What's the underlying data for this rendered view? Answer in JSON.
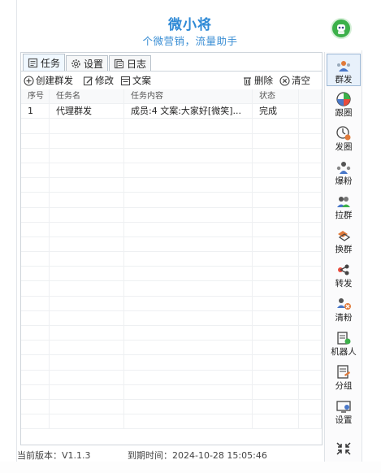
{
  "header": {
    "title": "微小将",
    "subtitle": "个微营销，流量助手"
  },
  "tabs": [
    {
      "label": "任务",
      "icon": "task-icon",
      "active": true
    },
    {
      "label": "设置",
      "icon": "gear-icon",
      "active": false
    },
    {
      "label": "日志",
      "icon": "log-icon",
      "active": false
    }
  ],
  "toolbar": {
    "create_label": "创建群发",
    "edit_label": "修改",
    "copy_label": "文案",
    "delete_label": "删除",
    "clear_label": "清空"
  },
  "table": {
    "columns": [
      "序号",
      "任务名",
      "任务内容",
      "状态"
    ],
    "rows": [
      {
        "index": "1",
        "name": "代理群发",
        "content": "成员:4 文案:大家好[微笑]...",
        "status": "完成"
      }
    ]
  },
  "sidebar": {
    "items": [
      {
        "label": "群发",
        "icon": "broadcast-icon",
        "active": true
      },
      {
        "label": "跟圈",
        "icon": "moments-follow-icon",
        "active": false
      },
      {
        "label": "发圈",
        "icon": "moments-post-icon",
        "active": false
      },
      {
        "label": "爆粉",
        "icon": "fans-boost-icon",
        "active": false
      },
      {
        "label": "拉群",
        "icon": "pull-group-icon",
        "active": false
      },
      {
        "label": "换群",
        "icon": "swap-group-icon",
        "active": false
      },
      {
        "label": "转发",
        "icon": "forward-icon",
        "active": false
      },
      {
        "label": "清粉",
        "icon": "clean-fans-icon",
        "active": false
      },
      {
        "label": "机器人",
        "icon": "robot-icon",
        "active": false
      },
      {
        "label": "分组",
        "icon": "group-icon",
        "active": false
      },
      {
        "label": "设置",
        "icon": "settings-icon",
        "active": false
      }
    ]
  },
  "status": {
    "version": "当前版本：V1.1.3",
    "expire": "到期时间：2024-10-28 15:05:46"
  },
  "colors": {
    "accent": "#2f8ad6",
    "brand_green": "#3cb04a"
  }
}
